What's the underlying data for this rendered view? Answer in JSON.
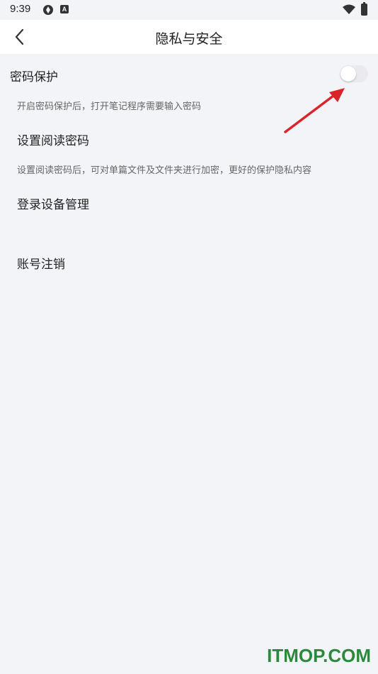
{
  "status_bar": {
    "time": "9:39",
    "icons": [
      "camera-aperture-icon",
      "a-badge-icon",
      "wifi-icon",
      "battery-icon"
    ]
  },
  "header": {
    "title": "隐私与安全",
    "back_icon": "chevron-left-icon"
  },
  "settings": {
    "password_protect": {
      "title": "密码保护",
      "description": "开启密码保护后，打开笔记程序需要输入密码",
      "enabled": false
    },
    "read_password": {
      "title": "设置阅读密码",
      "description": "设置阅读密码后，可对单篇文件及文件夹进行加密，更好的保护隐私内容"
    },
    "device_management": {
      "title": "登录设备管理"
    },
    "account_cancel": {
      "title": "账号注销"
    }
  },
  "colors": {
    "background": "#f3f4f8",
    "header": "#ffffff",
    "toggle_off": "#e9e9ee",
    "arrow": "#d9252a",
    "watermark": "#2a8a3a"
  },
  "watermark": "ITMOP.COM"
}
